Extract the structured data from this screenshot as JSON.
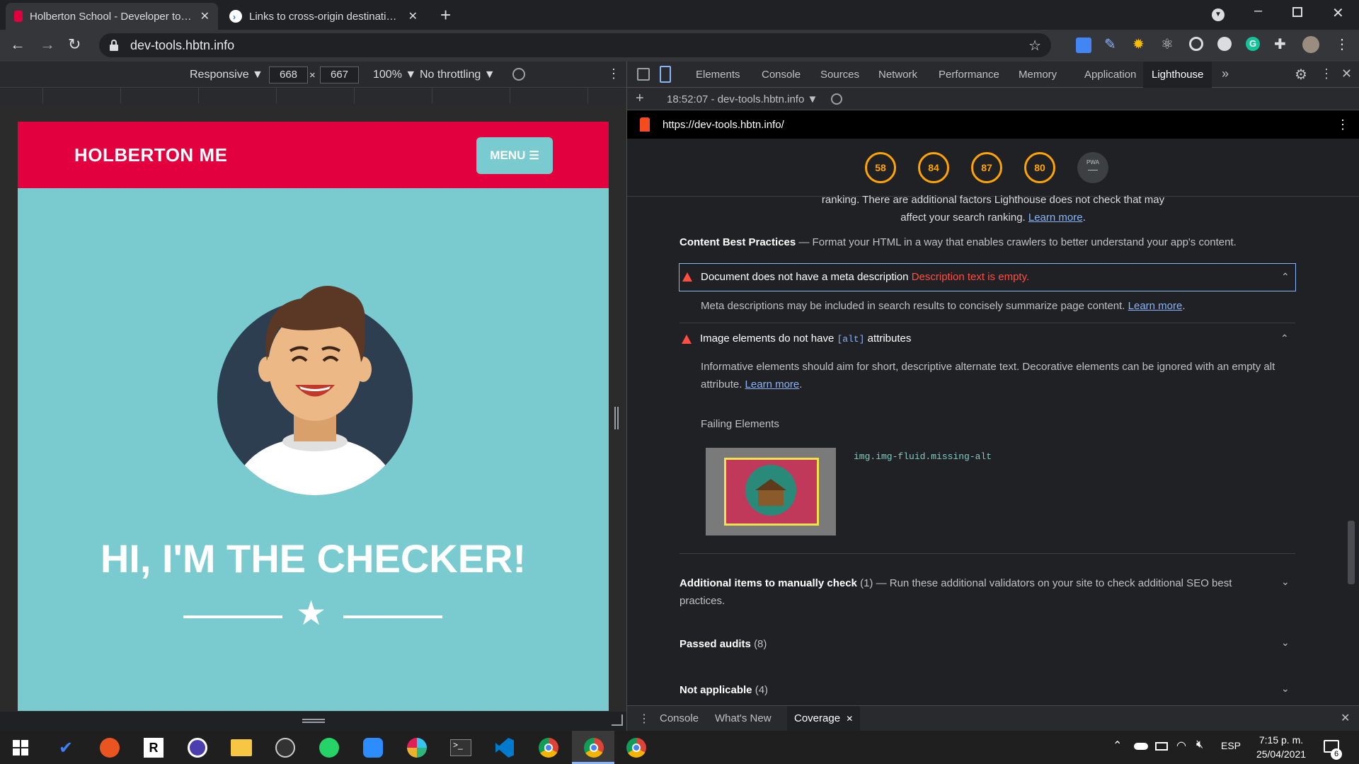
{
  "tabs": [
    {
      "title": "Holberton School - Developer tools",
      "active": true
    },
    {
      "title": "Links to cross-origin destinations",
      "active": false
    }
  ],
  "new_tab_label": "+",
  "address": "dev-tools.hbtn.info",
  "device_toolbar": {
    "device": "Responsive ▼",
    "width": "668",
    "times": "×",
    "height": "667",
    "zoom": "100% ▼",
    "throttle": "No throttling ▼"
  },
  "viewport": {
    "brand": "HOLBERTON ME",
    "menu": "MENU",
    "hero_title": "HI, I'M THE CHECKER!",
    "colors": {
      "nav": "#e2003f",
      "body": "#79cbd0"
    }
  },
  "devtools": {
    "tabs": [
      "Elements",
      "Console",
      "Sources",
      "Network",
      "Performance",
      "Memory",
      "Application",
      "Lighthouse"
    ],
    "active_tab": "Lighthouse",
    "report_selector": "18:52:07 - dev-tools.hbtn.info ▼",
    "url": "https://dev-tools.hbtn.info/",
    "scores": [
      "58",
      "84",
      "87",
      "80"
    ],
    "pwa_label": "PWA",
    "intro_line1": "ranking. There are additional factors Lighthouse does not check that may",
    "intro_line2": "affect your search ranking.",
    "learn_more": "Learn more",
    "section_title": "Content Best Practices",
    "section_desc": "— Format your HTML in a way that enables crawlers to better understand your app's content.",
    "audit1": {
      "title": "Document does not have a meta description",
      "error": "Description text is empty.",
      "desc": "Meta descriptions may be included in search results to concisely summarize page content."
    },
    "audit2": {
      "title_pre": "Image elements do not have",
      "code": "[alt]",
      "title_post": "attributes",
      "desc_line1": "Informative elements should aim for short, descriptive alternate text. Decorative elements can be ignored with an empty alt",
      "desc_line2": "attribute.",
      "failing_label": "Failing Elements",
      "selector": "img.img-fluid.missing-alt"
    },
    "additional": {
      "title": "Additional items to manually check",
      "count": "(1)",
      "desc_line1": "— Run these additional validators on your site to check additional SEO best",
      "desc_line2": "practices."
    },
    "passed": {
      "title": "Passed audits",
      "count": "(8)"
    },
    "not_applicable": {
      "title": "Not applicable",
      "count": "(4)"
    },
    "drawer_tabs": [
      "Console",
      "What's New",
      "Coverage"
    ]
  },
  "taskbar": {
    "language": "ESP",
    "time": "7:15 p. m.",
    "date": "25/04/2021",
    "notifications": "6"
  },
  "icons": {
    "gauge_color": "#ffa400",
    "error_color": "#ff4e42"
  }
}
